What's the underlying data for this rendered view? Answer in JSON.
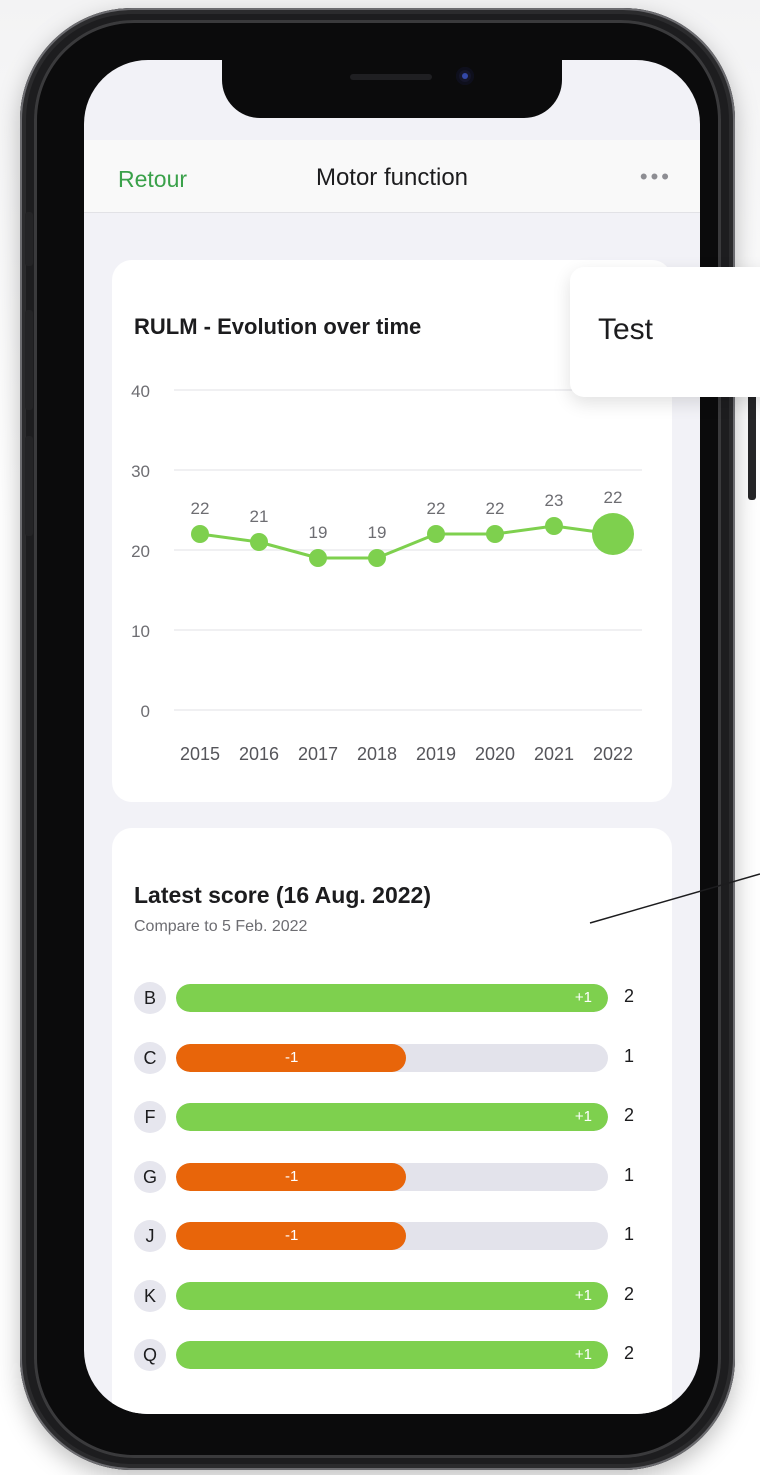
{
  "nav": {
    "back_label": "Retour",
    "title": "Motor function",
    "more_label": "•••"
  },
  "chart_card": {
    "title": "RULM - Evolution over time"
  },
  "chart_data": {
    "type": "line",
    "title": "RULM - Evolution over time",
    "categories": [
      "2015",
      "2016",
      "2017",
      "2018",
      "2019",
      "2020",
      "2021",
      "2022"
    ],
    "values": [
      22,
      21,
      19,
      19,
      22,
      22,
      23,
      22
    ],
    "value_labels": [
      "22",
      "21",
      "19",
      "19",
      "22",
      "22",
      "23",
      "22"
    ],
    "yticks": [
      "0",
      "10",
      "20",
      "30",
      "40"
    ],
    "ylim": [
      0,
      40
    ],
    "grid": true,
    "color": "#7ed04e",
    "highlight_last": true
  },
  "score_card": {
    "title": "Latest score (16 Aug. 2022)",
    "subtitle": "Compare to 5 Feb. 2022",
    "max_score": 2,
    "rows": [
      {
        "letter": "B",
        "delta": "+1",
        "value": "2",
        "score": 2,
        "color": "#7ed04e"
      },
      {
        "letter": "C",
        "delta": "-1",
        "value": "1",
        "score": 1,
        "color": "#e8650a"
      },
      {
        "letter": "F",
        "delta": "+1",
        "value": "2",
        "score": 2,
        "color": "#7ed04e"
      },
      {
        "letter": "G",
        "delta": "-1",
        "value": "1",
        "score": 1,
        "color": "#e8650a"
      },
      {
        "letter": "J",
        "delta": "-1",
        "value": "1",
        "score": 1,
        "color": "#e8650a"
      },
      {
        "letter": "K",
        "delta": "+1",
        "value": "2",
        "score": 2,
        "color": "#7ed04e"
      },
      {
        "letter": "Q",
        "delta": "+1",
        "value": "2",
        "score": 2,
        "color": "#7ed04e"
      }
    ]
  },
  "tooltip": {
    "text": "Test"
  },
  "colors": {
    "accent": "#3aa14a",
    "positive": "#7ed04e",
    "negative": "#e8650a",
    "track": "#e3e3eb"
  }
}
